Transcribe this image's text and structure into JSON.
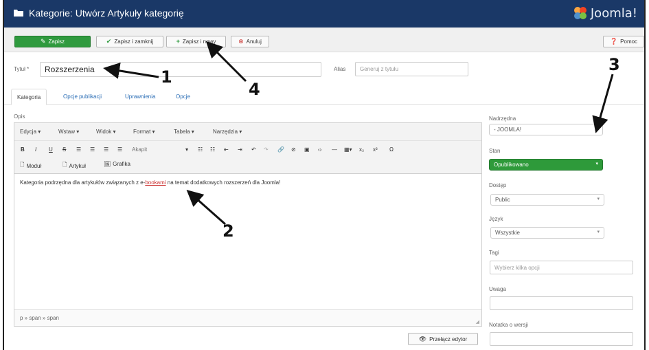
{
  "window": {
    "title": "Kategorie: Utwórz Artykuły kategorię",
    "brand": "Joomla!"
  },
  "toolbar": {
    "save": "Zapisz",
    "save_close": "Zapisz i zamknij",
    "save_new": "Zapisz i nowy",
    "cancel": "Anuluj",
    "help": "Pomoc"
  },
  "form": {
    "title_label": "Tytuł *",
    "title_value": "Rozszerzenia",
    "alias_label": "Alias",
    "alias_placeholder": "Generuj z tytułu"
  },
  "tabs": [
    "Kategoria",
    "Opcje publikacji",
    "Uprawnienia",
    "Opcje"
  ],
  "editor": {
    "label": "Opis",
    "menus": [
      "Edycja ▾",
      "Wstaw ▾",
      "Widok ▾",
      "Format ▾",
      "Tabela ▾",
      "Narzędzia ▾"
    ],
    "paragraph_select": "Akapit",
    "inserts": [
      "Moduł",
      "Artykuł",
      "Grafika"
    ],
    "content_before": "Kategoria podrzędna dla artykułów związanych z e-",
    "content_link": "bookami",
    "content_after": " na temat dodatkowych rozszerzeń dla Joomla!",
    "path": "p » span » span",
    "toggle": "Przełącz edytor"
  },
  "sidebar": {
    "parent_label": "Nadrzędna",
    "parent_value": "- JOOMLA!",
    "status_label": "Stan",
    "status_value": "Opublikowano",
    "access_label": "Dostęp",
    "access_value": "Public",
    "language_label": "Język",
    "language_value": "Wszystkie",
    "tags_label": "Tagi",
    "tags_placeholder": "Wybierz kilka opcji",
    "note_label": "Uwaga",
    "version_label": "Notatka o wersji"
  },
  "annotations": [
    "1",
    "2",
    "3",
    "4"
  ],
  "colors": {
    "titlebar": "#1a3867",
    "save_green": "#2f9a3e",
    "status_green": "#2e9a3a",
    "link_blue": "#2a6db5"
  }
}
